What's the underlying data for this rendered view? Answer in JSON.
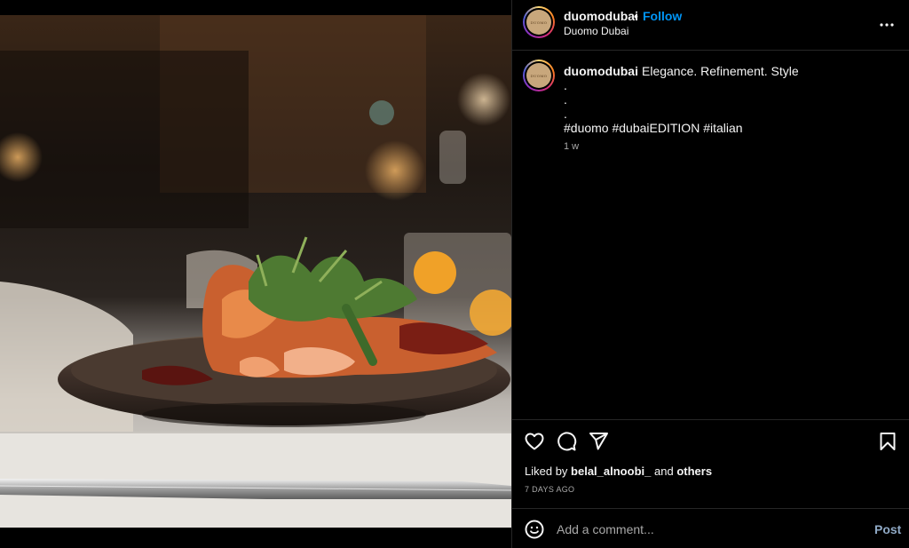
{
  "post": {
    "username": "duomodubai",
    "separator": "•",
    "follow_label": "Follow",
    "location": "Duomo Dubai",
    "avatar_text": "DUOMO",
    "more_icon": "more-horizontal-icon"
  },
  "caption": {
    "username": "duomodubai",
    "text": "Elegance. Refinement. Style",
    "dot1": ".",
    "dot2": ".",
    "dot3": ".",
    "hashtags": [
      "#duomo",
      "#dubaiEDITION",
      "#italian"
    ],
    "time": "1 w"
  },
  "actions": {
    "like_icon": "heart-icon",
    "comment_icon": "comment-icon",
    "share_icon": "send-icon",
    "save_icon": "bookmark-icon"
  },
  "likes": {
    "prefix": "Liked by",
    "user": "belal_alnoobi_",
    "conj": "and",
    "others": "others"
  },
  "date": "7 DAYS AGO",
  "comment": {
    "emoji_icon": "emoji-icon",
    "placeholder": "Add a comment...",
    "post_label": "Post"
  },
  "colors": {
    "background": "#000000",
    "link": "#0095f6",
    "muted": "#a8a8a8",
    "divider": "#262626"
  }
}
